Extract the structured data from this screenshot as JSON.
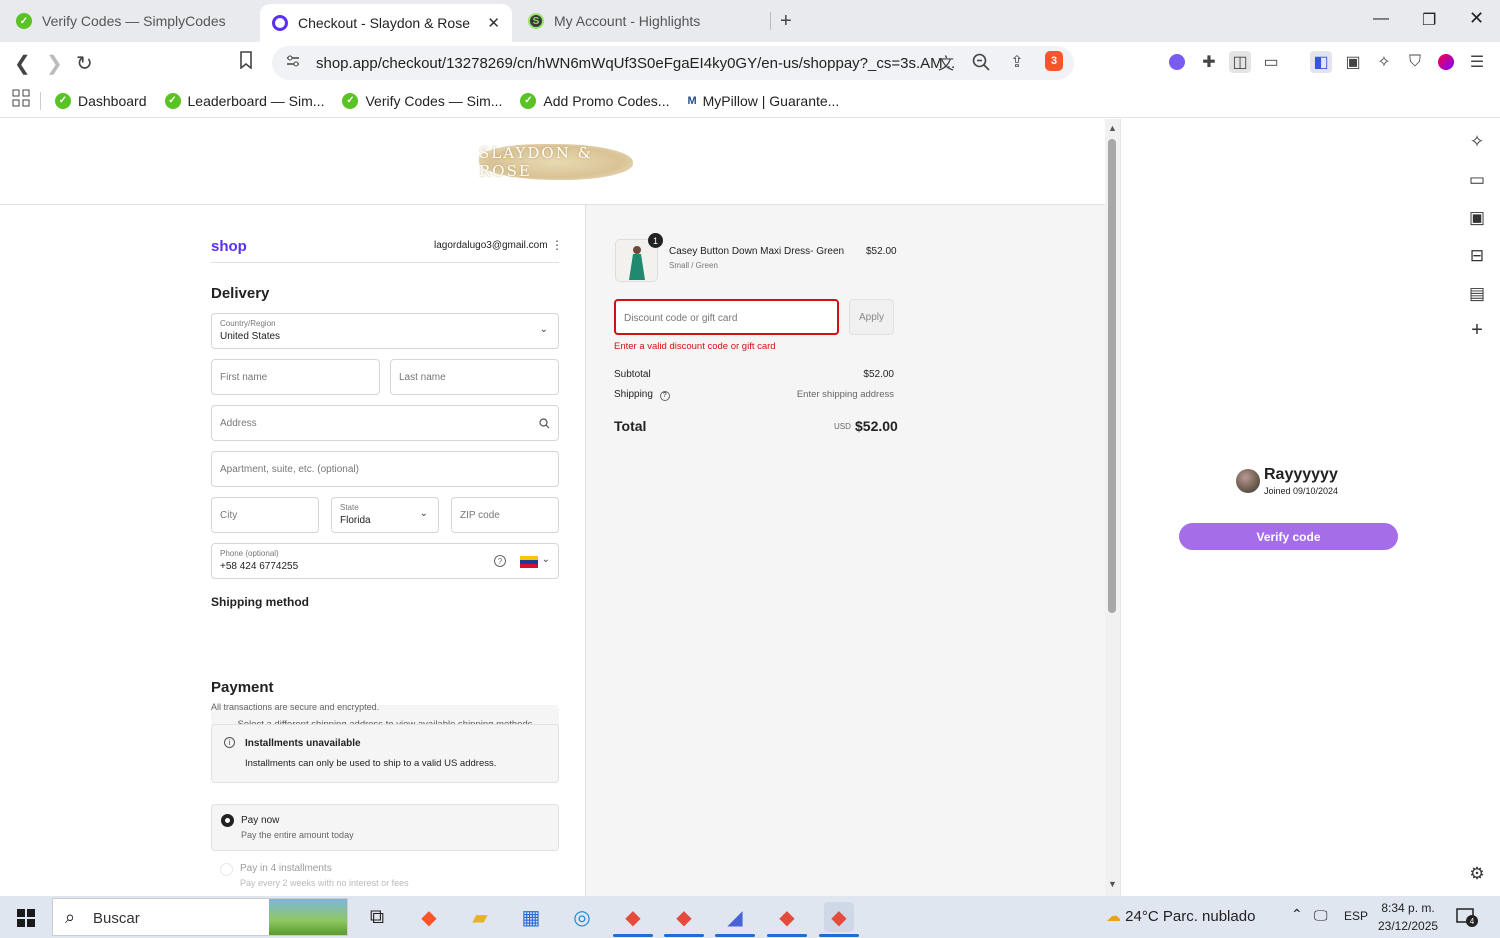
{
  "browser": {
    "tabs": [
      {
        "label": "Verify Codes — SimplyCodes",
        "active": false
      },
      {
        "label": "Checkout - Slaydon & Rose",
        "active": true
      },
      {
        "label": "My Account - Highlights",
        "active": false
      }
    ],
    "new_tab_icon": "plus-icon",
    "url": "shop.app/checkout/13278269/cn/hWN6mWqUf3S0eFgaEI4ky0GY/en-us/shoppay?_cs=3s.AM...",
    "brave_count": "3",
    "bookmarks": [
      {
        "label": "Dashboard"
      },
      {
        "label": "Leaderboard — Sim..."
      },
      {
        "label": "Verify Codes — Sim..."
      },
      {
        "label": "Add Promo Codes..."
      },
      {
        "label": "MyPillow | Guarante..."
      }
    ]
  },
  "store": {
    "logo_text": "SLAYDON & ROSE"
  },
  "checkout": {
    "shop_label": "shop",
    "email": "lagordalugo3@gmail.com",
    "delivery_title": "Delivery",
    "country_label": "Country/Region",
    "country_value": "United States",
    "first_name_ph": "First name",
    "last_name_ph": "Last name",
    "address_ph": "Address",
    "apartment_ph": "Apartment, suite, etc. (optional)",
    "city_ph": "City",
    "state_label": "State",
    "state_value": "Florida",
    "zip_ph": "ZIP code",
    "phone_label": "Phone (optional)",
    "phone_value": "+58 424 6774255",
    "shipping_method_title": "Shipping method",
    "shipping_method_note": "Select a different shipping address to view available shipping methods",
    "payment_title": "Payment",
    "payment_sub": "All transactions are secure and encrypted.",
    "installments_title": "Installments unavailable",
    "installments_text": "Installments can only be used to ship to a valid US address.",
    "pay_now_title": "Pay now",
    "pay_now_sub": "Pay the entire amount today",
    "pay4_title": "Pay in 4 installments",
    "pay4_sub": "Pay every 2 weeks with no interest or fees"
  },
  "summary": {
    "qty": "1",
    "product_name": "Casey Button Down Maxi Dress- Green",
    "product_variant": "Small / Green",
    "product_price": "$52.00",
    "discount_ph": "Discount code or gift card",
    "apply_label": "Apply",
    "error_text": "Enter a valid discount code or gift card",
    "subtotal_label": "Subtotal",
    "subtotal_value": "$52.00",
    "shipping_label": "Shipping",
    "shipping_value": "Enter shipping address",
    "total_label": "Total",
    "currency": "USD",
    "total_value": "$52.00"
  },
  "sidepanel": {
    "user_name": "Rayyyyyy",
    "joined": "Joined 09/10/2024",
    "verify_label": "Verify code"
  },
  "taskbar": {
    "search_text": "Buscar",
    "weather": "24°C  Parc. nublado",
    "lang": "ESP",
    "time": "8:34 p. m.",
    "date": "23/12/2025",
    "notifications": "4"
  },
  "colors": {
    "shop_purple": "#5a31f4",
    "error_red": "#d21212",
    "verify_button": "#a66de8"
  }
}
